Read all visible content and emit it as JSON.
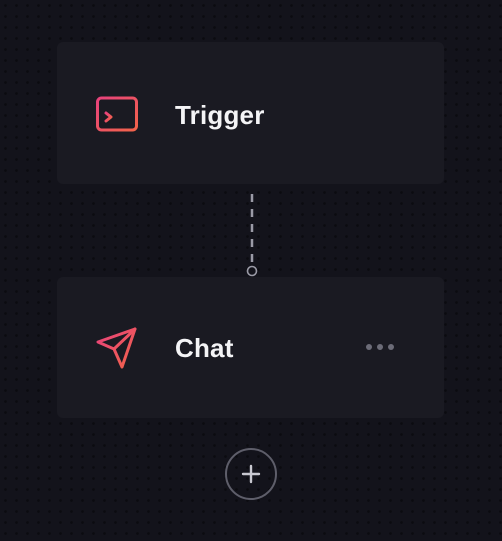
{
  "workflow": {
    "nodes": [
      {
        "label": "Trigger",
        "icon": "terminal-window-icon"
      },
      {
        "label": "Chat",
        "icon": "paper-plane-icon",
        "menu_icon": "more-horizontal-icon"
      }
    ],
    "add_node_icon": "plus-icon"
  },
  "colors": {
    "background": "#13131b",
    "card": "#1a1a22",
    "text": "#f4f4f6",
    "accent_gradient_start": "#e8427c",
    "accent_gradient_end": "#f2634a",
    "muted": "#6c6c78",
    "connector": "#9a9aa6"
  }
}
